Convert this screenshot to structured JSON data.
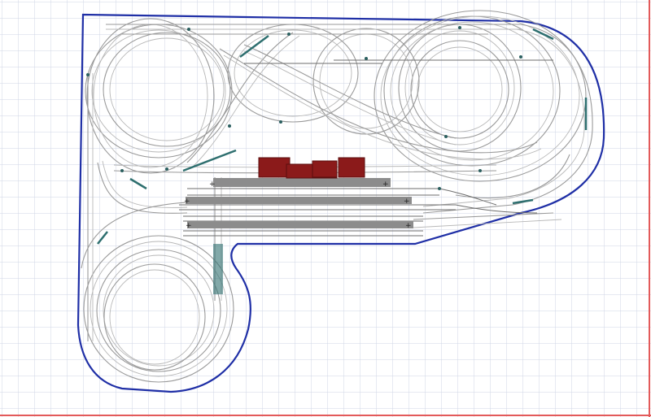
{
  "diagram": {
    "background": "#ffffff",
    "grid_color": "#cfd6e6",
    "edge_color": "#e35a5a",
    "baseboard_outline_color": "#1f2fa6",
    "track_color": "#9a9a9a",
    "track_highlight_color": "#2e6f6f",
    "building_color": "#8b1a1a",
    "platform_color": "#8c8c8c"
  }
}
